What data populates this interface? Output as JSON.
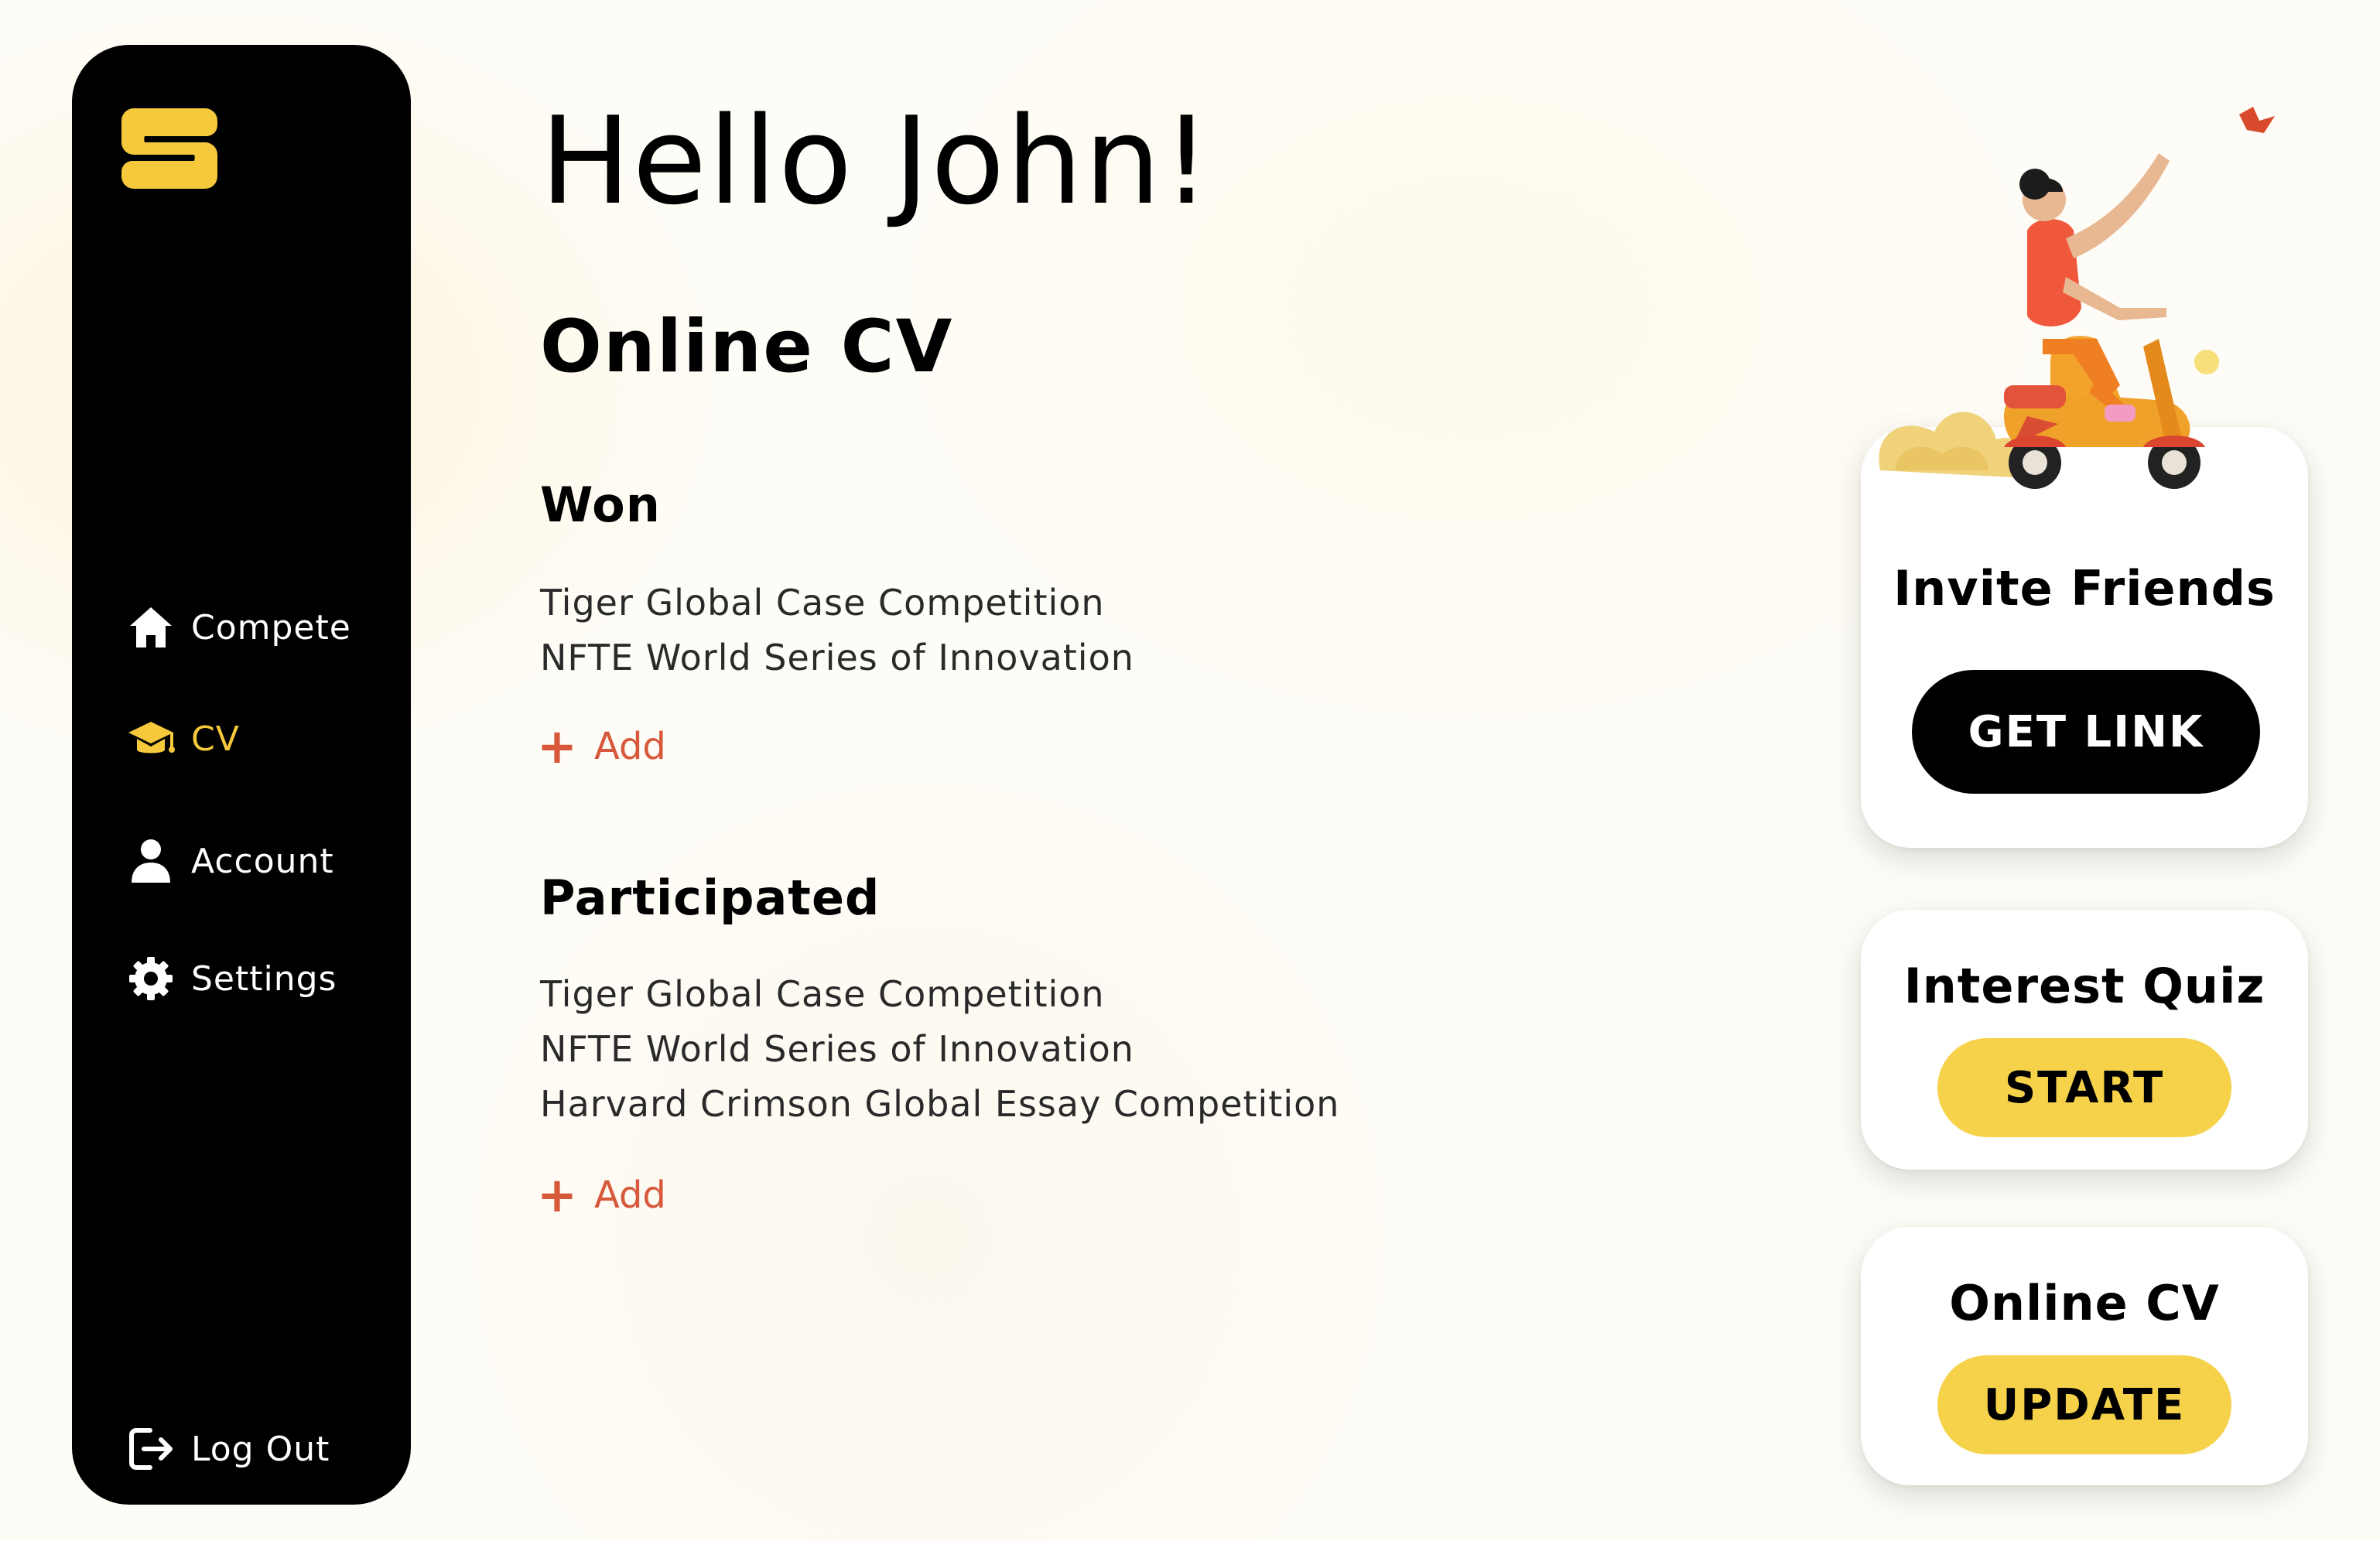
{
  "sidebar": {
    "items": [
      {
        "label": "Compete",
        "icon": "home-icon",
        "active": false
      },
      {
        "label": "CV",
        "icon": "graduation-cap-icon",
        "active": true
      },
      {
        "label": "Account",
        "icon": "user-icon",
        "active": false
      },
      {
        "label": "Settings",
        "icon": "gear-icon",
        "active": false
      }
    ],
    "logout_label": "Log Out",
    "logout_icon": "logout-icon",
    "logo_icon": "s-logo-icon",
    "accent_color": "#f5c93b"
  },
  "main": {
    "greeting": "Hello John!",
    "section_title": "Online CV",
    "won": {
      "title": "Won",
      "entries": [
        "Tiger Global Case Competition",
        "NFTE World Series of Innovation"
      ],
      "add_label": "Add"
    },
    "participated": {
      "title": "Participated",
      "entries": [
        "Tiger Global Case Competition",
        "NFTE World Series of Innovation",
        "Harvard Crimson Global Essay Competition"
      ],
      "add_label": "Add"
    },
    "add_color": "#d7583a"
  },
  "cards": {
    "invite": {
      "title": "Invite Friends",
      "button": "GET LINK",
      "illustration": "scooter-rider-illustration"
    },
    "quiz": {
      "title": "Interest Quiz",
      "button": "START"
    },
    "cv": {
      "title": "Online CV",
      "button": "UPDATE"
    },
    "button_yellow": "#f5d24a"
  }
}
